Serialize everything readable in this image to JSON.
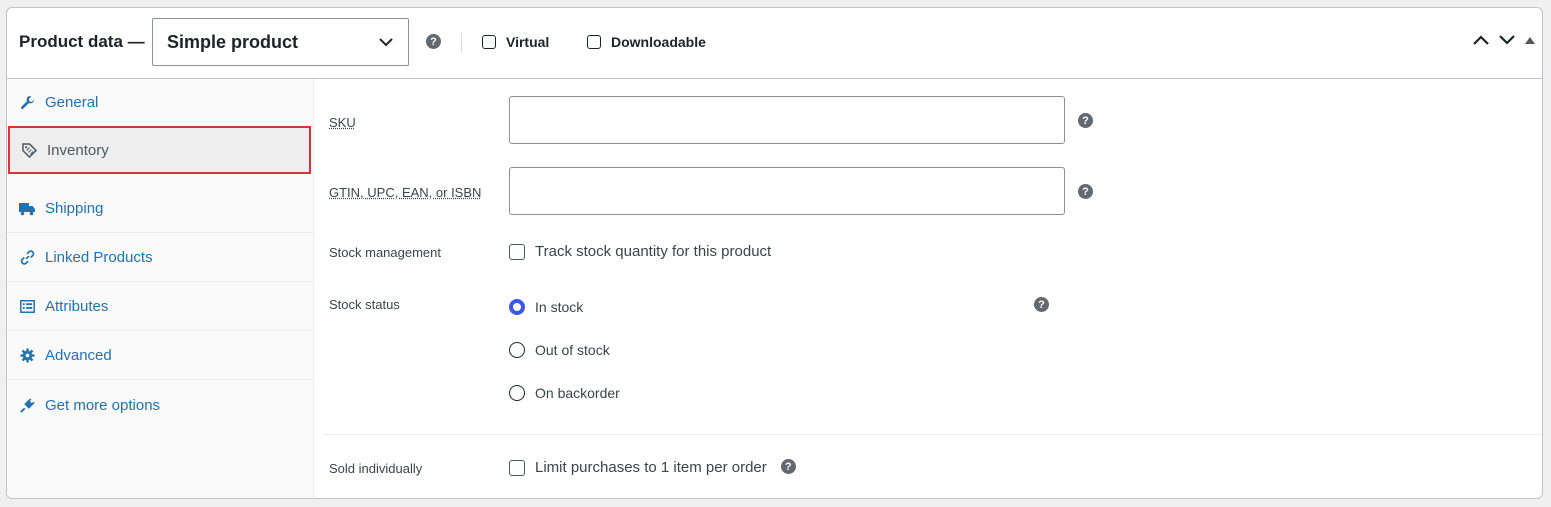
{
  "header": {
    "title": "Product data —",
    "product_type": "Simple product",
    "virtual_label": "Virtual",
    "downloadable_label": "Downloadable",
    "help_glyph": "?"
  },
  "sidebar": {
    "items": [
      {
        "label": "General",
        "icon": "wrench-icon"
      },
      {
        "label": "Inventory",
        "icon": "tag-icon",
        "active": true
      },
      {
        "label": "Shipping",
        "icon": "truck-icon"
      },
      {
        "label": "Linked Products",
        "icon": "link-icon"
      },
      {
        "label": "Attributes",
        "icon": "list-icon"
      },
      {
        "label": "Advanced",
        "icon": "gear-icon"
      },
      {
        "label": "Get more options",
        "icon": "plugin-icon"
      }
    ]
  },
  "inventory": {
    "sku_label": "SKU",
    "sku_value": "",
    "gtin_label": "GTIN, UPC, EAN, or ISBN",
    "gtin_value": "",
    "stock_management_label": "Stock management",
    "stock_management_checkbox": "Track stock quantity for this product",
    "stock_status_label": "Stock status",
    "stock_options": [
      "In stock",
      "Out of stock",
      "On backorder"
    ],
    "stock_selected": "In stock",
    "sold_individually_label": "Sold individually",
    "sold_individually_checkbox": "Limit purchases to 1 item per order"
  },
  "colors": {
    "link": "#2271b1",
    "active_outline": "#d63638",
    "radio_selected": "#3858e9"
  }
}
